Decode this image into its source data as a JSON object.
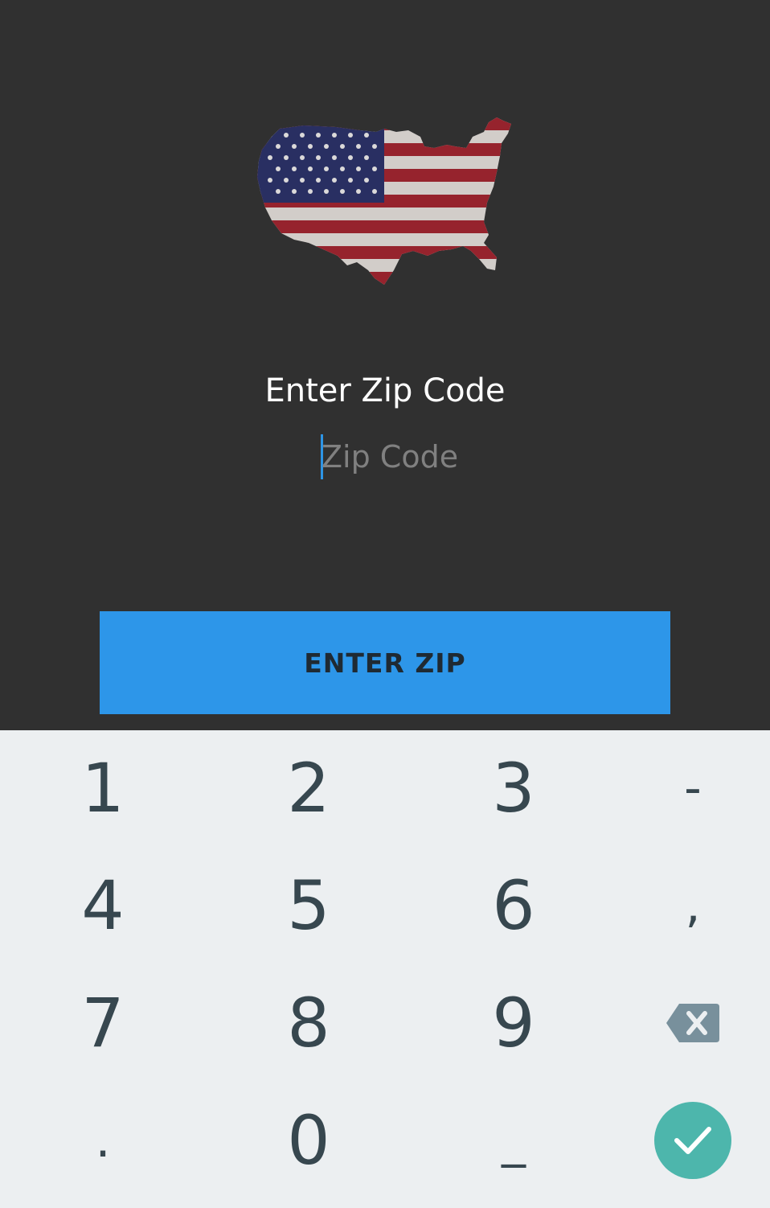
{
  "header": {
    "title": "Enter Zip Code"
  },
  "zip": {
    "value": "",
    "placeholder": "Zip Code"
  },
  "actions": {
    "enter_label": "ENTER ZIP"
  },
  "keyboard": {
    "keys": [
      "1",
      "2",
      "3",
      "-",
      "4",
      "5",
      "6",
      ",",
      "7",
      "8",
      "9",
      ".",
      "0",
      "_"
    ],
    "icons": {
      "backspace": "backspace-icon",
      "done": "check-icon"
    }
  },
  "colors": {
    "background": "#303030",
    "accent": "#2d96e9",
    "keyboard_bg": "#eceff1",
    "key_text": "#37474f",
    "done_button": "#4db6ac"
  }
}
